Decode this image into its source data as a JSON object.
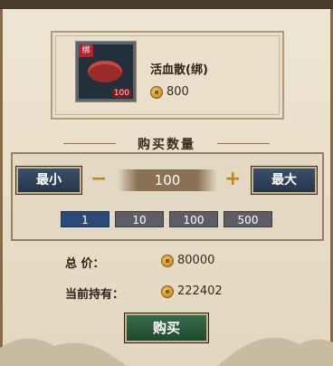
{
  "item": {
    "name": "活血散(绑)",
    "tag": "绑",
    "stack_count": "100",
    "price": "800",
    "icon": "red-cloth-icon"
  },
  "quantity": {
    "title": "购买数量",
    "min_label": "最小",
    "max_label": "最大",
    "minus_label": "−",
    "plus_label": "+",
    "value": "100",
    "presets": [
      "1",
      "10",
      "100",
      "500"
    ],
    "selected_preset": "1"
  },
  "summary": {
    "total_label": "总  价：",
    "total_value": "80000",
    "holding_label": "当前持有：",
    "holding_value": "222402"
  },
  "actions": {
    "buy_label": "购买"
  },
  "colors": {
    "button_blue": "#2c4a78",
    "button_green": "#1f4a30",
    "coin_gold": "#d9a23a"
  }
}
